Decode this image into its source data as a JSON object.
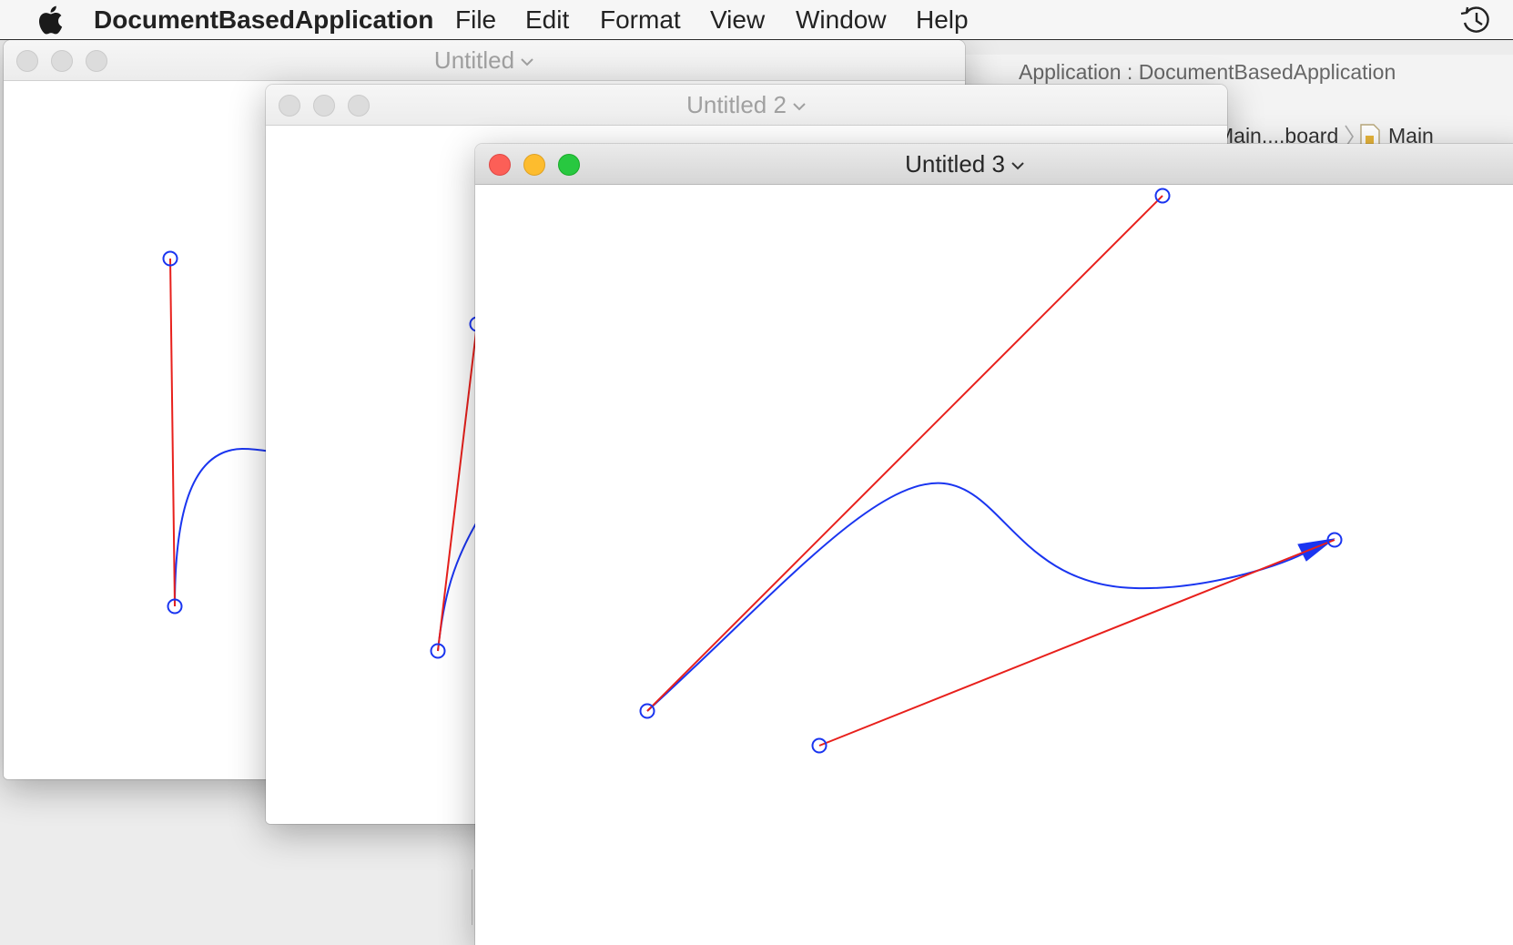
{
  "menubar": {
    "apple_icon": "apple-logo-icon",
    "app_name": "DocumentBasedApplication",
    "items": [
      "File",
      "Edit",
      "Format",
      "View",
      "Window",
      "Help"
    ],
    "status_icon": "time-machine-icon"
  },
  "background_xcode": {
    "title": "Application : DocumentBasedApplication",
    "breadcrumb_1": "Main....board",
    "breadcrumb_2": "Main"
  },
  "windows": [
    {
      "title": "Untitled",
      "active": false
    },
    {
      "title": "Untitled 2",
      "active": false
    },
    {
      "title": "Untitled 3",
      "active": true
    }
  ],
  "colors": {
    "curve": "#1a35f0",
    "control_line": "#e8201c",
    "handle": "#1a35f0",
    "close": "#fc5f57",
    "minimize": "#fdbc2e",
    "zoom": "#28c840"
  }
}
